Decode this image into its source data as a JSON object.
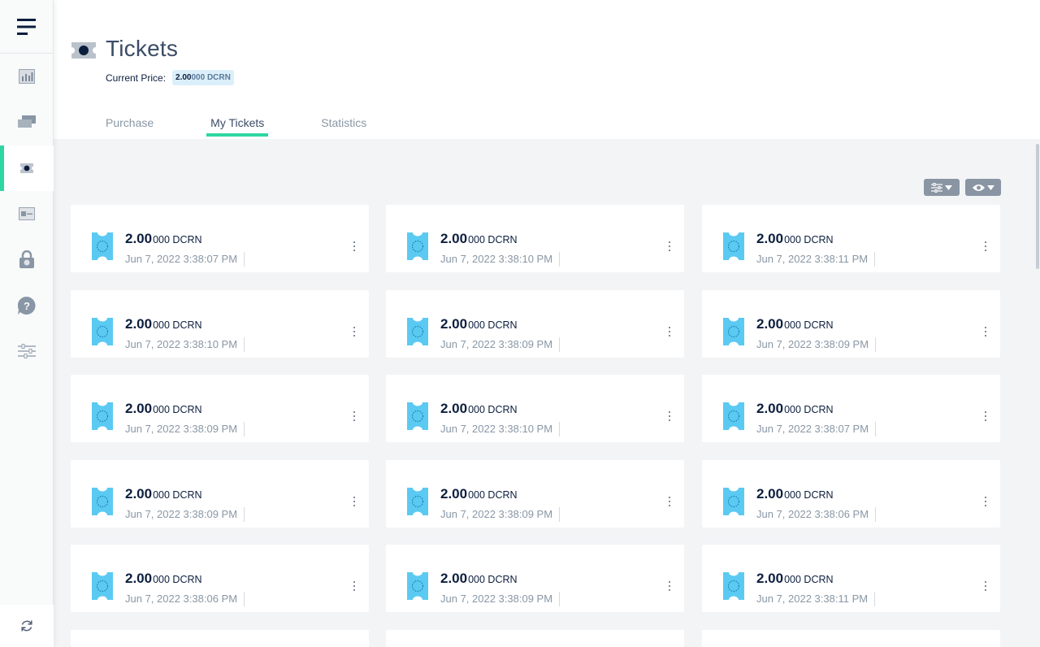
{
  "sidebar": {
    "items": [
      {
        "name": "overview"
      },
      {
        "name": "transactions"
      },
      {
        "name": "tickets",
        "active": true
      },
      {
        "name": "accounts"
      },
      {
        "name": "security"
      },
      {
        "name": "help"
      },
      {
        "name": "settings"
      }
    ]
  },
  "header": {
    "title": "Tickets",
    "price_label": "Current Price:",
    "price_main": "2.00",
    "price_rest": "000 DCRN"
  },
  "tabs": [
    {
      "label": "Purchase",
      "active": false
    },
    {
      "label": "My Tickets",
      "active": true
    },
    {
      "label": "Statistics",
      "active": false
    }
  ],
  "toolbar": {
    "filter_icon": "sliders-icon",
    "view_icon": "eye-icon"
  },
  "colors": {
    "accent": "#2ed6a1",
    "ticket_icon": "#5bcaf2",
    "title": "#3b4c66",
    "muted": "#8997a5"
  },
  "tickets": [
    {
      "amount_main": "2.00",
      "amount_rest": "000 DCRN",
      "date": "Jun 7, 2022 3:38:07 PM"
    },
    {
      "amount_main": "2.00",
      "amount_rest": "000 DCRN",
      "date": "Jun 7, 2022 3:38:10 PM"
    },
    {
      "amount_main": "2.00",
      "amount_rest": "000 DCRN",
      "date": "Jun 7, 2022 3:38:11 PM"
    },
    {
      "amount_main": "2.00",
      "amount_rest": "000 DCRN",
      "date": "Jun 7, 2022 3:38:10 PM"
    },
    {
      "amount_main": "2.00",
      "amount_rest": "000 DCRN",
      "date": "Jun 7, 2022 3:38:09 PM"
    },
    {
      "amount_main": "2.00",
      "amount_rest": "000 DCRN",
      "date": "Jun 7, 2022 3:38:09 PM"
    },
    {
      "amount_main": "2.00",
      "amount_rest": "000 DCRN",
      "date": "Jun 7, 2022 3:38:09 PM"
    },
    {
      "amount_main": "2.00",
      "amount_rest": "000 DCRN",
      "date": "Jun 7, 2022 3:38:10 PM"
    },
    {
      "amount_main": "2.00",
      "amount_rest": "000 DCRN",
      "date": "Jun 7, 2022 3:38:07 PM"
    },
    {
      "amount_main": "2.00",
      "amount_rest": "000 DCRN",
      "date": "Jun 7, 2022 3:38:09 PM"
    },
    {
      "amount_main": "2.00",
      "amount_rest": "000 DCRN",
      "date": "Jun 7, 2022 3:38:09 PM"
    },
    {
      "amount_main": "2.00",
      "amount_rest": "000 DCRN",
      "date": "Jun 7, 2022 3:38:06 PM"
    },
    {
      "amount_main": "2.00",
      "amount_rest": "000 DCRN",
      "date": "Jun 7, 2022 3:38:06 PM"
    },
    {
      "amount_main": "2.00",
      "amount_rest": "000 DCRN",
      "date": "Jun 7, 2022 3:38:09 PM"
    },
    {
      "amount_main": "2.00",
      "amount_rest": "000 DCRN",
      "date": "Jun 7, 2022 3:38:11 PM"
    }
  ]
}
